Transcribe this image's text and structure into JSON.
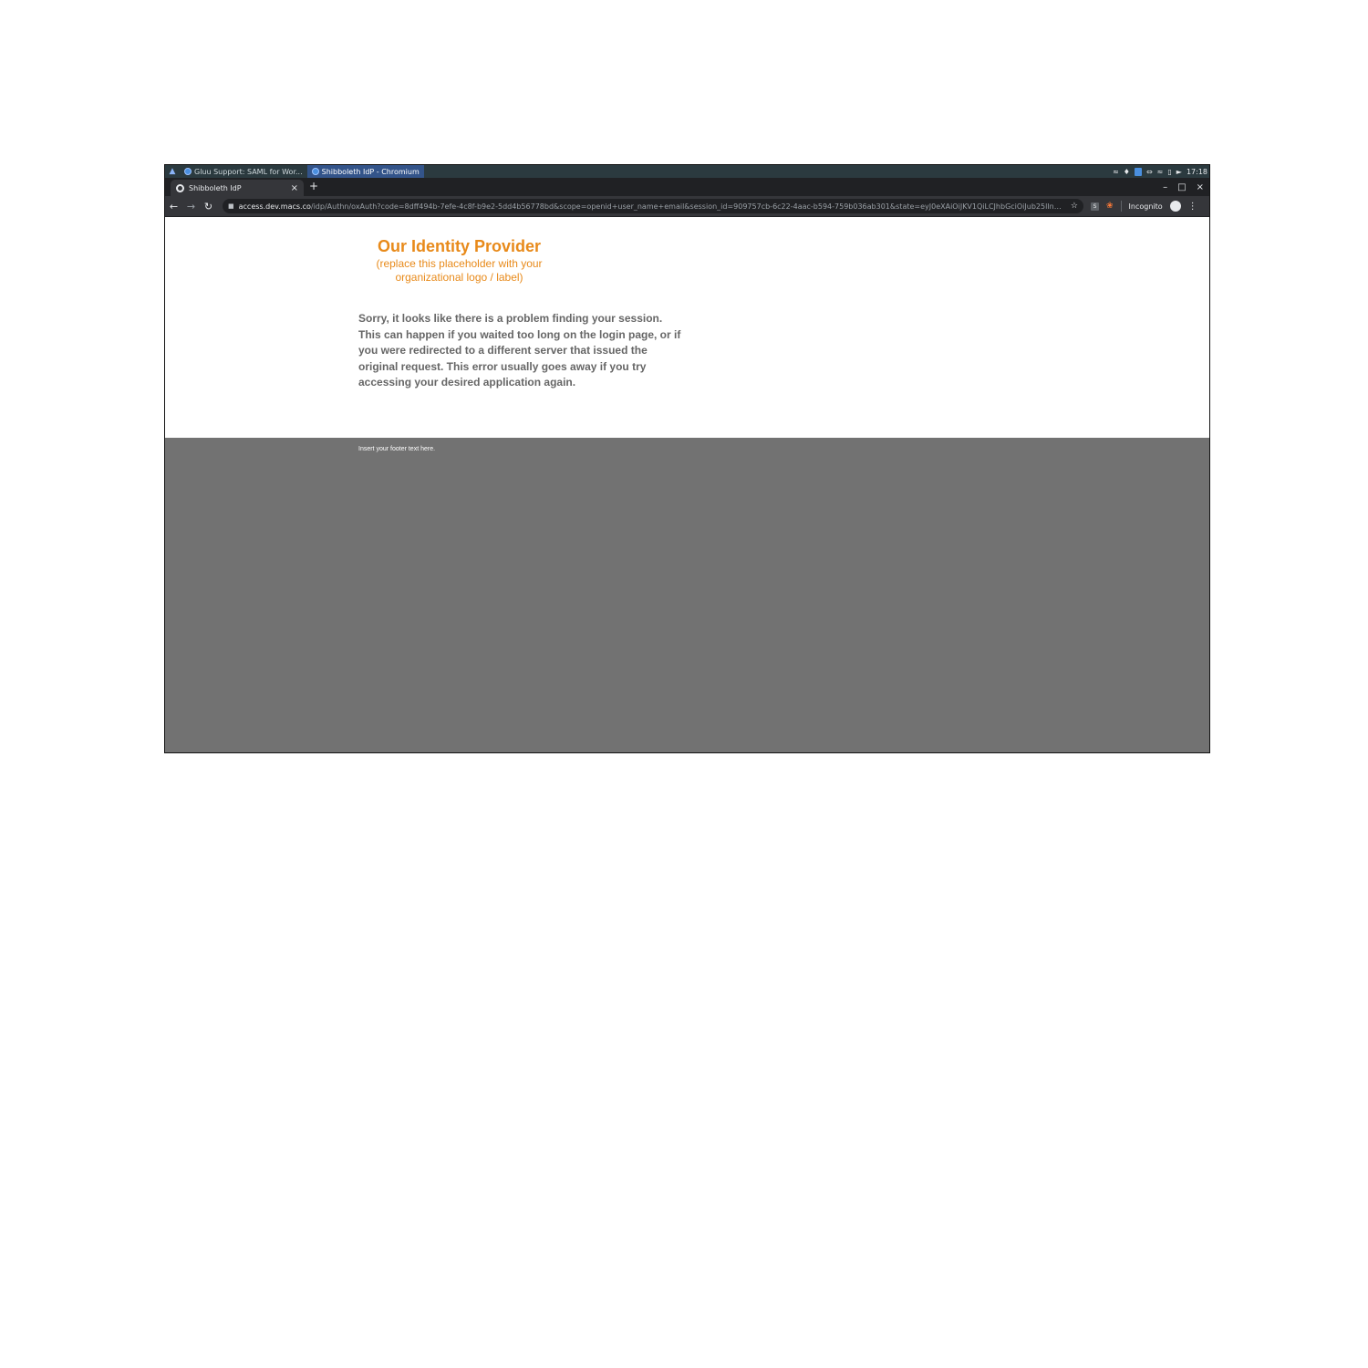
{
  "taskbar": {
    "tasks": [
      {
        "label": "Gluu Support: SAML for Wor..."
      },
      {
        "label": "Shibboleth IdP - Chromium"
      }
    ],
    "clock": "17:18"
  },
  "browser": {
    "tab_title": "Shibboleth IdP",
    "new_tab": "+",
    "url_host": "access.dev.macs.co",
    "url_path": "/idp/Authn/oxAuth?code=8dff494b-7efe-4c8f-b9e2-5dd4b56778bd&scope=openid+user_name+email&session_id=909757cb-6c22-4aac-b594-759b036ab301&state=eyJ0eXAiOiJKV1QiLCJhbGciOiJub25lIn0.eyJ...",
    "incognito_label": "Incognito"
  },
  "page": {
    "logo_title": "Our Identity Provider",
    "logo_subtitle_line1": "(replace this placeholder with your",
    "logo_subtitle_line2": "organizational logo / label)",
    "error_message": "Sorry, it looks like there is a problem finding your session. This can happen if you waited too long on the login page, or if you were redirected to a different server that issued the original request. This error usually goes away if you try accessing your desired application again.",
    "footer_text": "Insert your footer text here."
  },
  "colors": {
    "accent": "#e88a1a",
    "message_text": "#666666",
    "footer_bg": "#727272"
  }
}
